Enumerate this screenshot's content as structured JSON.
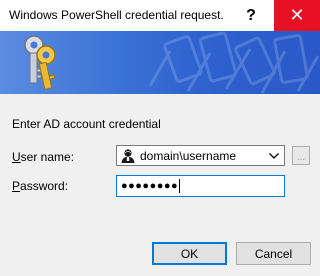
{
  "window": {
    "title": "Windows PowerShell credential request.",
    "help_glyph": "?",
    "close_glyph": "✕"
  },
  "banner": {
    "icon": "keys-icon",
    "colors": {
      "light": "#5b8ce0",
      "dark": "#2a58c8"
    }
  },
  "form": {
    "prompt": "Enter AD account credential",
    "user_label": {
      "accel": "U",
      "rest": "ser name:"
    },
    "user_value": "domain\\username",
    "browse_label": "...",
    "password_label": {
      "accel": "P",
      "rest": "assword:"
    },
    "password_mask": "●●●●●●●●"
  },
  "buttons": {
    "ok": "OK",
    "cancel": "Cancel"
  },
  "colors": {
    "close_red": "#e81123",
    "focus_blue": "#0078d7",
    "dialog_bg": "#f0f0f0"
  }
}
